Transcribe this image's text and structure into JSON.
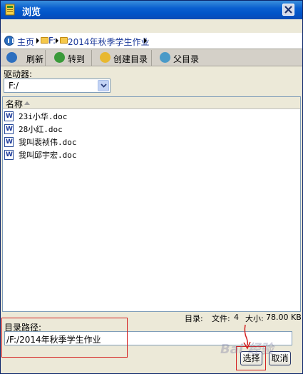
{
  "window": {
    "title": "浏览"
  },
  "breadcrumb": {
    "home": "主页",
    "drive": "F:",
    "folder": "2014年秋季学生作业"
  },
  "toolbar": {
    "refresh": "刷新",
    "goto": "转到",
    "create_dir": "创建目录",
    "parent_dir": "父目录"
  },
  "drive": {
    "label": "驱动器:",
    "selected": "F:/"
  },
  "file_list": {
    "column_name": "名称",
    "files": [
      "23i小华.doc",
      "28小红.doc",
      "我叫裴祯伟.doc",
      "我叫邱宇宏.doc"
    ]
  },
  "status": {
    "dir_label": "目录:",
    "files_label": "文件:",
    "files_count": "4",
    "size_label": "大小:",
    "size_value": "78.00 KB"
  },
  "path": {
    "label": "目录路径:",
    "value": "/F:/2014年秋季学生作业"
  },
  "buttons": {
    "select": "选择",
    "cancel": "取消"
  },
  "watermark": "Bai 经验"
}
